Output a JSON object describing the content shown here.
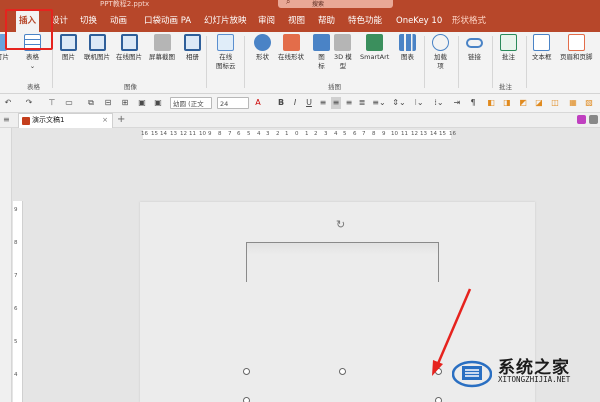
{
  "window": {
    "file_name": "PPT教程2.pptx",
    "search_label": "搜索"
  },
  "tabs": [
    {
      "label": "插入",
      "active": true
    },
    {
      "label": "设计"
    },
    {
      "label": "切换"
    },
    {
      "label": "动画"
    },
    {
      "label": "口袋动画 PA"
    },
    {
      "label": "幻灯片放映"
    },
    {
      "label": "审阅"
    },
    {
      "label": "视图"
    },
    {
      "label": "帮助"
    },
    {
      "label": "特色功能"
    },
    {
      "label": "OneKey 10"
    },
    {
      "label": "形状格式"
    }
  ],
  "ribbon": {
    "buttons": {
      "new_slide_tail": "灯片",
      "table": "表格",
      "picture": "图片",
      "online_picture": "联机图片",
      "online_image": "在线图片",
      "screenshot": "屏幕截图",
      "album": "相册",
      "online_icon_cloud_1": "在线",
      "online_icon_cloud_2": "图标云",
      "shapes": "形状",
      "online_shapes": "在线形状",
      "icons_1": "图",
      "icons_2": "标",
      "model_3d_1": "3D 模",
      "model_3d_2": "型",
      "smartart": "SmartArt",
      "chart": "图表",
      "addins_1": "加载",
      "addins_2": "项",
      "link": "链接",
      "comment": "批注",
      "textbox": "文本框",
      "header_footer": "页眉和页脚"
    },
    "groups": {
      "tables": "表格",
      "images": "图像",
      "illustrations": "插图",
      "comments": "批注"
    }
  },
  "quick_access": {
    "font_name": "幼圆 (正文",
    "font_size": "24"
  },
  "doc_tab": {
    "name": "演示文稿1"
  },
  "ruler": {
    "horizontal": [
      "16",
      "15",
      "14",
      "13",
      "12",
      "11",
      "10",
      "9",
      "8",
      "7",
      "6",
      "5",
      "4",
      "3",
      "2",
      "1",
      "0",
      "1",
      "2",
      "3",
      "4",
      "5",
      "6",
      "7",
      "8",
      "9",
      "10",
      "11",
      "12",
      "13",
      "14",
      "15",
      "16"
    ],
    "vertical": [
      "9",
      "8",
      "7",
      "6",
      "5",
      "4"
    ]
  },
  "watermark": {
    "title": "系统之家",
    "url": "XITONGZHIJIA.NET"
  },
  "colors": {
    "brand": "#b7472a",
    "highlight": "#e6231e"
  }
}
